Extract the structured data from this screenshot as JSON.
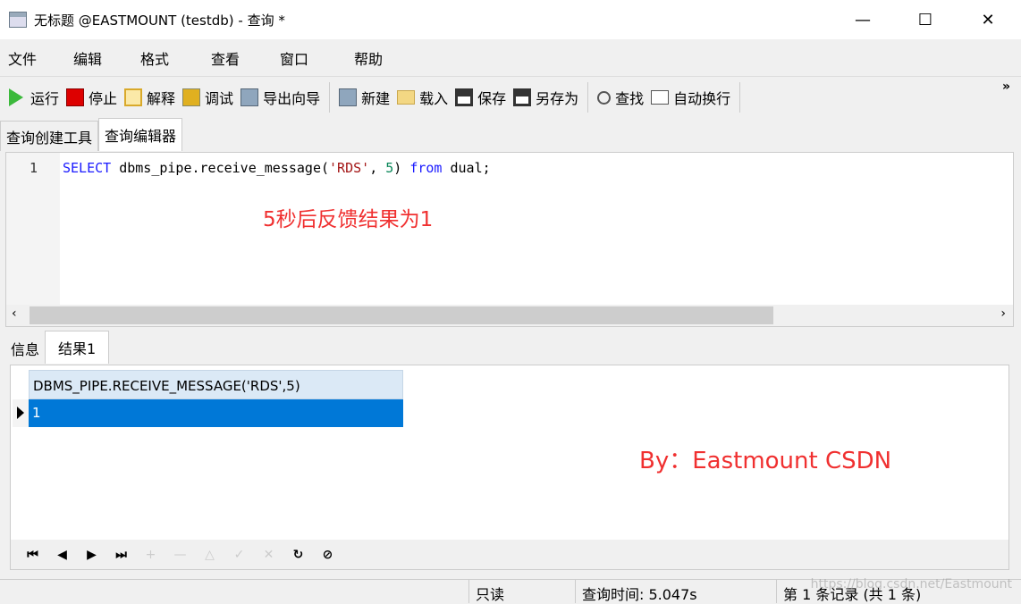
{
  "window": {
    "title": "无标题 @EASTMOUNT (testdb) - 查询 *",
    "minimize": "—",
    "maximize": "☐",
    "close": "✕"
  },
  "menu": [
    "文件",
    "编辑",
    "格式",
    "查看",
    "窗口",
    "帮助"
  ],
  "toolbar": {
    "run": "运行",
    "stop": "停止",
    "explain": "解释",
    "debug": "调试",
    "export": "导出向导",
    "new": "新建",
    "load": "载入",
    "save": "保存",
    "save_as": "另存为",
    "find": "查找",
    "wrap": "自动换行",
    "more": "»"
  },
  "tabs": [
    "查询创建工具",
    "查询编辑器"
  ],
  "editor": {
    "line": "1",
    "code": {
      "kw1": "SELECT",
      "t1": " dbms_pipe.receive_message(",
      "s1": "'RDS'",
      "t2": ", ",
      "n1": "5",
      "t3": ") ",
      "kw2": "from",
      "t4": " dual;"
    },
    "annotation": "5秒后反馈结果为1"
  },
  "result_tabs": [
    "信息",
    "结果1"
  ],
  "grid": {
    "column": "DBMS_PIPE.RECEIVE_MESSAGE('RDS',5)",
    "rows": [
      "1"
    ],
    "annotation": "By：Eastmount CSDN"
  },
  "status": {
    "readonly": "只读",
    "query_time": "查询时间: 5.047s",
    "record": "第 1 条记录 (共 1 条)"
  },
  "watermark": "https://blog.csdn.net/Eastmount",
  "colors": {
    "accent": "#0078d7",
    "annotation": "#f03030",
    "keyword": "#1a1aff"
  }
}
